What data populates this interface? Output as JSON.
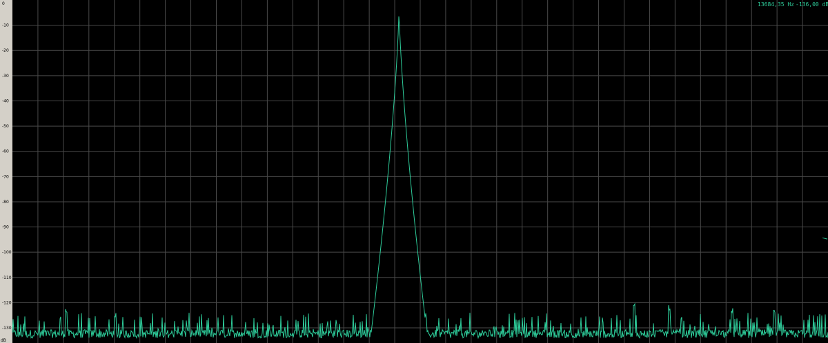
{
  "readout": {
    "frequency": "13684,35 Hz",
    "level": "-136,00 dB"
  },
  "colors": {
    "background": "#000000",
    "grid": "#4a4a4a",
    "trace": "#2ecc9a",
    "axis_panel": "#d4d0c8",
    "axis_text": "#000000"
  },
  "chart_data": {
    "type": "line",
    "title": "",
    "xlabel": "",
    "ylabel": "dB",
    "y_ticks": [
      "0",
      "-10",
      "-20",
      "-30",
      "-40",
      "-50",
      "-60",
      "-70",
      "-80",
      "-90",
      "-100",
      "-110",
      "-120",
      "-130"
    ],
    "ylim": [
      -136,
      0
    ],
    "grid": true,
    "legend": "none",
    "series": [
      {
        "noise_floor_db": [
          -134,
          -128
        ],
        "peaks": [
          {
            "position": 0.474,
            "level_db": -3
          },
          {
            "position": 0.066,
            "level_db": -124
          },
          {
            "position": 0.762,
            "level_db": -122
          },
          {
            "position": 0.805,
            "level_db": -123
          },
          {
            "position": 0.882,
            "level_db": -124
          },
          {
            "position": 0.934,
            "level_db": -125
          }
        ]
      }
    ]
  }
}
